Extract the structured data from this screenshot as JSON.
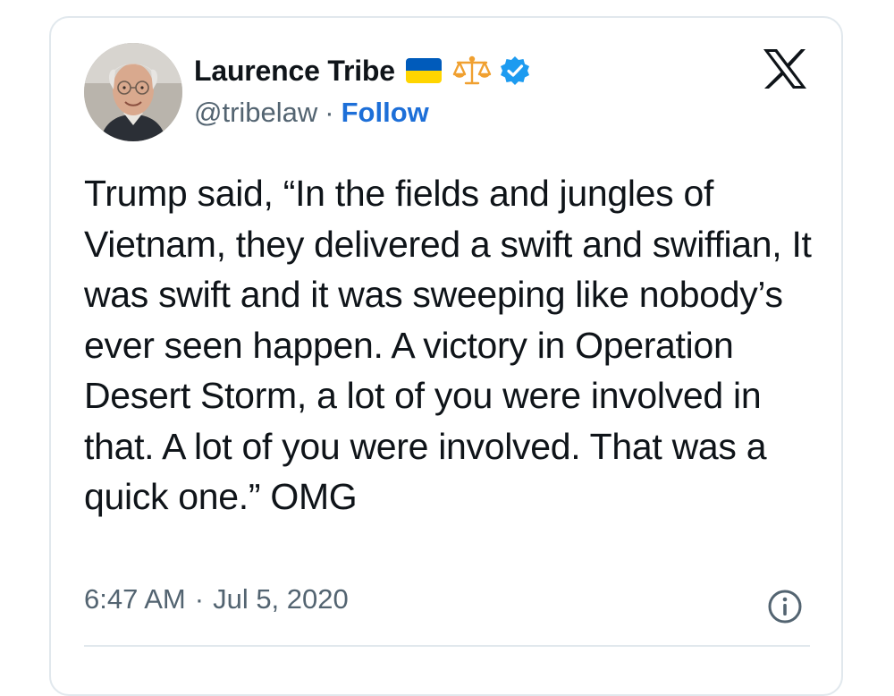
{
  "author": {
    "display_name": "Laurence Tribe",
    "handle": "@tribelaw",
    "follow_label": "Follow",
    "badges": [
      "ukraine-flag-icon",
      "scales-icon",
      "verified-badge-icon"
    ]
  },
  "tweet": {
    "text": "Trump said, “In the fields and jungles of Vietnam, they delivered a swift and swiffian, It was swift and it was sweeping like nobody’s ever seen happen. A victory in Operation Desert Storm, a lot of you were involved in that. A lot of you were involved. That was a quick one.” OMG",
    "time": "6:47 AM",
    "date": "Jul 5, 2020",
    "separator": "·"
  },
  "colors": {
    "text": "#0f1419",
    "secondary": "#536471",
    "link": "#1d6fd8",
    "verified": "#1d9bf0",
    "flag_blue": "#005bbb",
    "flag_yellow": "#ffd500",
    "scales": "#f0a030",
    "border": "#e1e8ed"
  }
}
